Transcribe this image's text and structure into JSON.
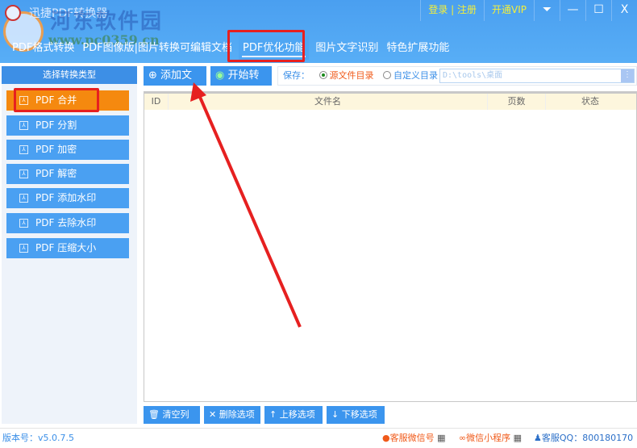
{
  "app": {
    "title": "迅捷PDF转换器",
    "watermark_name": "河东软件园",
    "watermark_url": "www.pc0359.cn"
  },
  "topbar": {
    "login": "登录 | 注册",
    "vip": "开通VIP",
    "menu": "⏷",
    "minimize": "—",
    "maximize": "☐",
    "close": "X"
  },
  "tabs": [
    "PDF格式转换",
    "PDF图像版|图片转换可编辑文档",
    "PDF优化功能",
    "图片文字识别",
    "特色扩展功能"
  ],
  "sidebar": {
    "header": "选择转换类型",
    "items": [
      "PDF 合并",
      "PDF 分割",
      "PDF 加密",
      "PDF 解密",
      "PDF 添加水印",
      "PDF 去除水印",
      "PDF 压缩大小"
    ]
  },
  "toolbar": {
    "add_file": "添加文件",
    "start": "开始转换",
    "save_label": "保存：",
    "opt_source": "源文件目录",
    "opt_custom": "自定义目录",
    "path": "D:\\tools\\桌面",
    "path_btn": "⋮"
  },
  "table": {
    "columns": [
      "ID",
      "文件名",
      "页数",
      "状态"
    ]
  },
  "bottom_buttons": [
    "清空列表",
    "删除选项",
    "上移选项",
    "下移选项"
  ],
  "footer": {
    "version": "版本号：v5.0.7.5",
    "wechat": "客服微信号",
    "miniapp": "微信小程序",
    "qq": "客服QQ：800180170"
  }
}
